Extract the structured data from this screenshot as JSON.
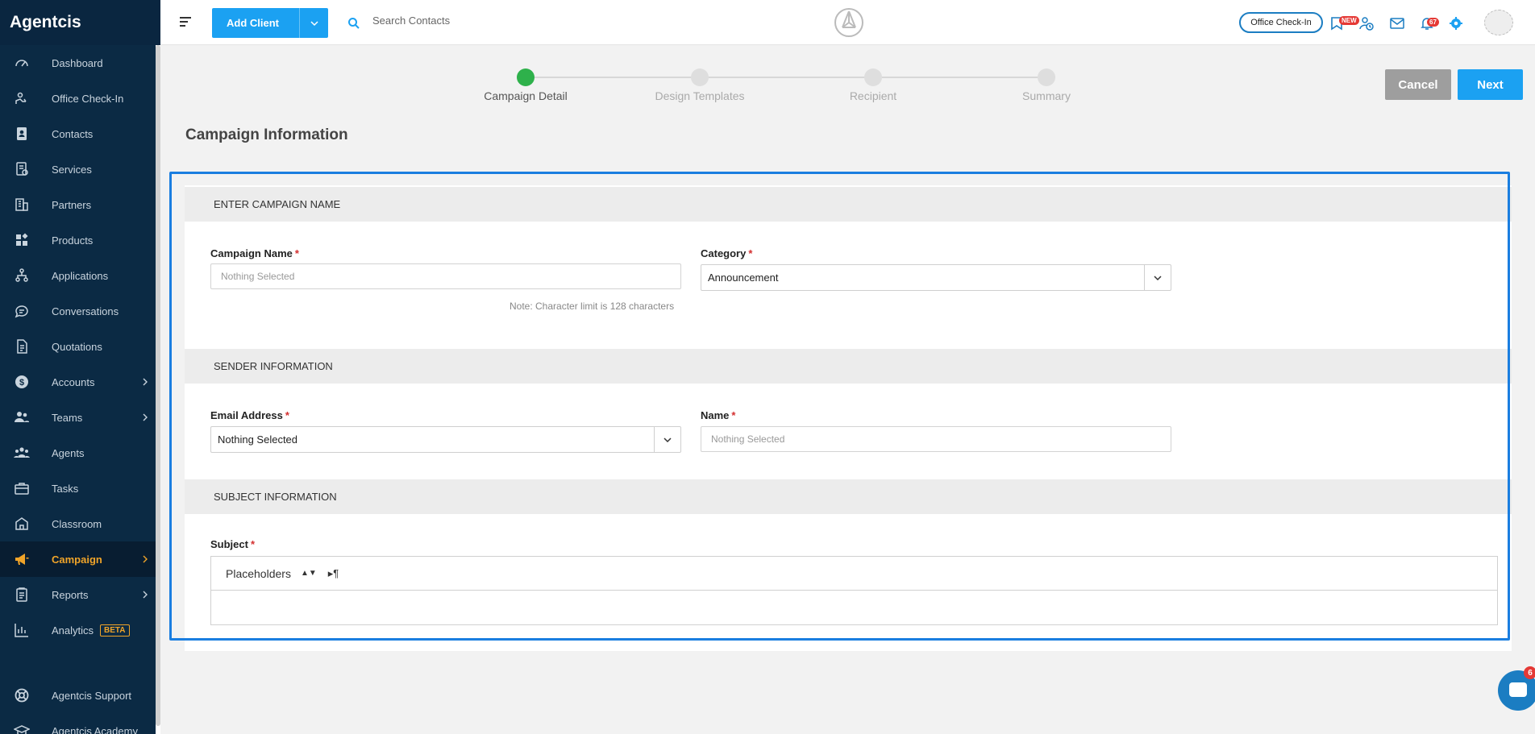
{
  "app": {
    "brand": "Agentcis"
  },
  "sidebar": {
    "items": [
      {
        "label": "Dashboard",
        "icon": "gauge-icon"
      },
      {
        "label": "Office Check-In",
        "icon": "checkin-icon"
      },
      {
        "label": "Contacts",
        "icon": "contact-card-icon"
      },
      {
        "label": "Services",
        "icon": "services-icon"
      },
      {
        "label": "Partners",
        "icon": "building-icon"
      },
      {
        "label": "Products",
        "icon": "products-icon"
      },
      {
        "label": "Applications",
        "icon": "flow-icon"
      },
      {
        "label": "Conversations",
        "icon": "chat-icon"
      },
      {
        "label": "Quotations",
        "icon": "document-icon"
      },
      {
        "label": "Accounts",
        "icon": "dollar-icon"
      },
      {
        "label": "Teams",
        "icon": "team-icon"
      },
      {
        "label": "Agents",
        "icon": "agents-icon"
      },
      {
        "label": "Tasks",
        "icon": "briefcase-icon"
      },
      {
        "label": "Classroom",
        "icon": "classroom-icon"
      },
      {
        "label": "Campaign",
        "icon": "megaphone-icon"
      },
      {
        "label": "Reports",
        "icon": "clipboard-icon"
      },
      {
        "label": "Analytics",
        "icon": "chart-icon",
        "badge": "BETA"
      }
    ],
    "bottom_items": [
      {
        "label": "Agentcis Support"
      },
      {
        "label": "Agentcis Academy"
      }
    ]
  },
  "topbar": {
    "add_client_label": "Add Client",
    "search_placeholder": "Search Contacts",
    "office_checkin_label": "Office Check-In",
    "new_badge": "NEW",
    "notifications_count": "67"
  },
  "stepper": {
    "steps": [
      "Campaign Detail",
      "Design Templates",
      "Recipient",
      "Summary"
    ],
    "current": 0
  },
  "actions": {
    "cancel": "Cancel",
    "next": "Next"
  },
  "page": {
    "title": "Campaign Information",
    "sections": {
      "campaign": "ENTER CAMPAIGN NAME",
      "sender": "SENDER INFORMATION",
      "subject": "SUBJECT INFORMATION"
    },
    "campaign_name": {
      "label": "Campaign Name",
      "placeholder": "Nothing Selected",
      "note": "Note: Character limit is 128 characters"
    },
    "category": {
      "label": "Category",
      "value": "Announcement"
    },
    "email": {
      "label": "Email Address",
      "value": "Nothing Selected"
    },
    "name": {
      "label": "Name",
      "placeholder": "Nothing Selected"
    },
    "subject": {
      "label": "Subject",
      "placeholders_label": "Placeholders",
      "format_symbol": "¶"
    },
    "required_mark": "*"
  },
  "chat": {
    "badge": "6"
  },
  "colors": {
    "sidebar_bg": "#0b2a44",
    "accent": "#1ba1f2",
    "active": "#f0a429",
    "step_done": "#2eb14b",
    "highlight": "#1a7ee0"
  }
}
